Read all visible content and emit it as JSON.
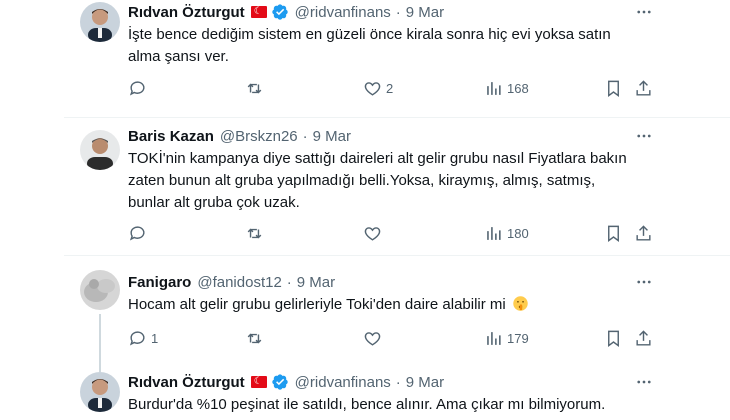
{
  "tweets": [
    {
      "name": "Rıdvan Özturgut",
      "handle": "@ridvanfinans",
      "date": "9 Mar",
      "text_lines": [
        "İşte bence dediğim sistem en güzeli önce kirala sonra hiç evi yoksa satın",
        "alma şansı ver."
      ],
      "replies": "",
      "retweets": "",
      "likes": "2",
      "views": "168"
    },
    {
      "name": "Baris Kazan",
      "handle": "@Brskzn26",
      "date": "9 Mar",
      "text_lines": [
        "TOKİ'nin kampanya diye sattığı daireleri alt gelir grubu nasıl Fiyatlara bakın",
        "zaten bunun alt gruba yapılmadığı belli.Yoksa, kiraymış, almış, satmış,",
        "bunlar alt gruba çok uzak."
      ],
      "replies": "",
      "retweets": "",
      "likes": "",
      "views": "180"
    },
    {
      "name": "Fanigaro",
      "handle": "@fanidost12",
      "date": "9 Mar",
      "text_lines": [
        "Hocam alt gelir grubu gelirleriyle Toki'den daire alabilir mi"
      ],
      "replies": "1",
      "retweets": "",
      "likes": "",
      "views": "179"
    },
    {
      "name": "Rıdvan Özturgut",
      "handle": "@ridvanfinans",
      "date": "9 Mar",
      "text_lines": [
        "Burdur'da %10 peşinat ile satıldı, bence alınır. Ama çıkar mı bilmiyorum."
      ]
    }
  ],
  "dot": "·",
  "icons": {
    "more": "more-horizontal-icon",
    "reply": "reply-icon",
    "retweet": "retweet-icon",
    "like": "heart-icon",
    "views": "views-icon",
    "bookmark": "bookmark-icon",
    "share": "share-icon",
    "verified": "verified-badge-icon",
    "flag": "turkey-flag-icon",
    "emoji": "shushing-face-emoji"
  },
  "colors": {
    "verified": "#1d9bf0",
    "muted": "#536471",
    "text": "#0f1419",
    "flag": "#e30a17"
  }
}
